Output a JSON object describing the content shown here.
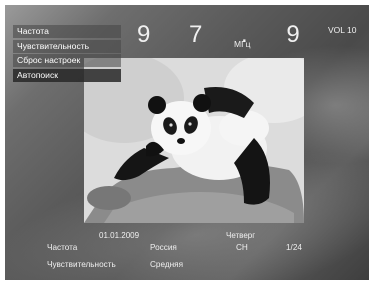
{
  "menu": {
    "items": [
      {
        "label": "Частота"
      },
      {
        "label": "Чувствительность"
      },
      {
        "label": "Сброс настроек"
      },
      {
        "label": "Автопоиск"
      }
    ]
  },
  "radio": {
    "frequency": "9 7 . 9",
    "unit": "МГц",
    "volume": "VOL 10"
  },
  "photo": {
    "subject": "panda-on-rock"
  },
  "status": {
    "date": "01.01.2009",
    "day": "Четверг"
  },
  "info": {
    "freq_label": "Частота",
    "freq_region": "Россия",
    "channel_label": "CH",
    "channel_value": "1/24",
    "sens_label": "Чувствительность",
    "sens_value": "Средняя"
  },
  "colors": {
    "text": "#f0f0f0",
    "menu_selected": "#282828"
  }
}
